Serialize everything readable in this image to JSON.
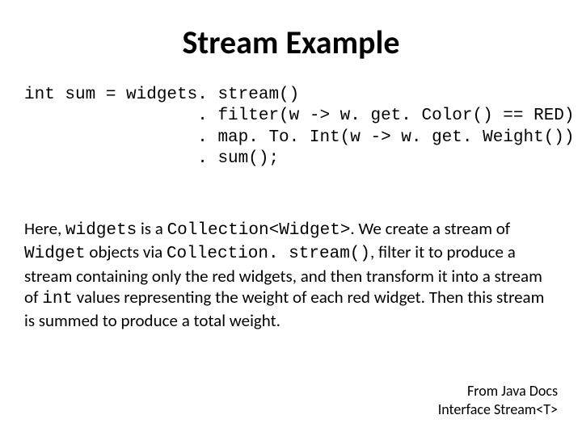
{
  "title": "Stream Example",
  "code": "int sum = widgets. stream()\n                 . filter(w -> w. get. Color() == RED)\n                 . map. To. Int(w -> w. get. Weight())\n                 . sum();",
  "desc": {
    "p1a": "Here, ",
    "p1b": "widgets",
    "p1c": " is a ",
    "p1d": "Collection<Widget>",
    "p1e": ". We create a stream of ",
    "p2a": "Widget",
    "p2b": " objects via ",
    "p2c": "Collection. stream()",
    "p2d": ", filter it to produce a stream containing only the red widgets, and then transform it into a stream of ",
    "p3a": "int",
    "p3b": " values representing the weight of each red widget. Then this stream is summed to produce a total weight."
  },
  "footer": {
    "line1": "From Java Docs",
    "line2": "Interface Stream<T>"
  }
}
